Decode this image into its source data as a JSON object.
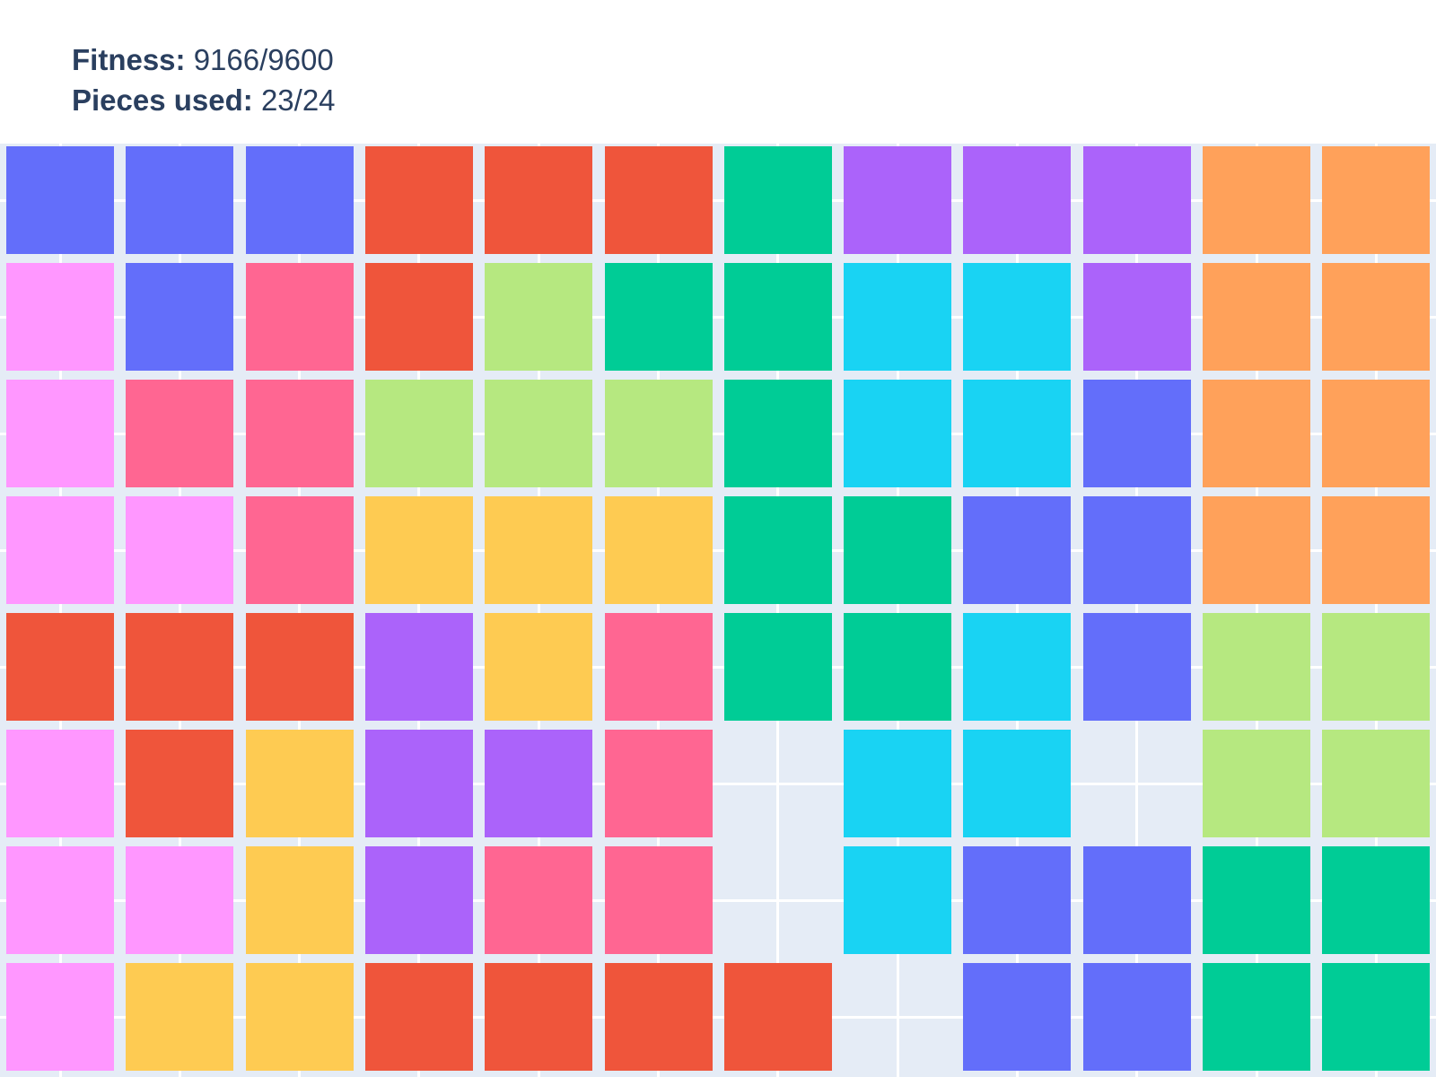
{
  "stats": {
    "fitness_label": "Fitness:",
    "fitness_value": "9166/9600",
    "pieces_label": "Pieces used:",
    "pieces_value": "23/24"
  },
  "board": {
    "rows": 8,
    "cols": 12,
    "empty_color": "#E5ECF6",
    "palette": {
      "B": "#636EFA",
      "R": "#EF553B",
      "G": "#00CC96",
      "P": "#AB63FA",
      "O": "#FFA15A",
      "K": "#FF97FF",
      "M": "#FF6692",
      "L": "#B6E880",
      "C": "#19D3F3",
      "Y": "#FECB52"
    },
    "cells": [
      [
        "B",
        "B",
        "B",
        "R",
        "R",
        "R",
        "G",
        "P",
        "P",
        "P",
        "O",
        "O"
      ],
      [
        "K",
        "B",
        "M",
        "R",
        "L",
        "G",
        "G",
        "C",
        "C",
        "P",
        "O",
        "O"
      ],
      [
        "K",
        "M",
        "M",
        "L",
        "L",
        "L",
        "G",
        "C",
        "C",
        "B",
        "O",
        "O"
      ],
      [
        "K",
        "K",
        "M",
        "Y",
        "Y",
        "Y",
        "G",
        "G",
        "B",
        "B",
        "O",
        "O"
      ],
      [
        "R",
        "R",
        "R",
        "P",
        "Y",
        "M",
        "G",
        "G",
        "C",
        "B",
        "L",
        "L"
      ],
      [
        "K",
        "R",
        "Y",
        "P",
        "P",
        "M",
        "",
        "C",
        "C",
        "",
        "L",
        "L"
      ],
      [
        "K",
        "K",
        "Y",
        "P",
        "M",
        "M",
        "",
        "C",
        "B",
        "B",
        "G",
        "G"
      ],
      [
        "K",
        "Y",
        "Y",
        "R",
        "R",
        "R",
        "R",
        "",
        "B",
        "B",
        "G",
        "G"
      ]
    ]
  }
}
